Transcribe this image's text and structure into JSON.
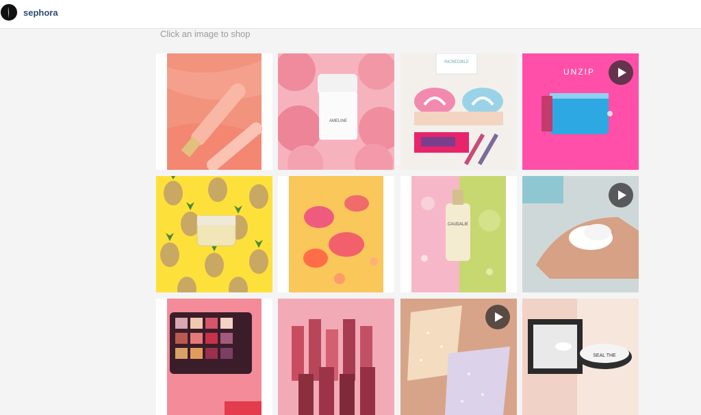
{
  "profile": {
    "username": "sephora",
    "avatar_icon": "sephora-logo-icon"
  },
  "hint": "Click an image to shop",
  "tiles": [
    {
      "label": "pink gloss tube"
    },
    {
      "label": "rose cream jar",
      "jar_text": "AMELINE"
    },
    {
      "label": "rainbow palette",
      "pack_text": "INCREDIBLE"
    },
    {
      "label": "unzip pouch",
      "overlay_text": "UNZIP",
      "video": true
    },
    {
      "label": "pineapple cream"
    },
    {
      "label": "blush compacts"
    },
    {
      "label": "caudalie serum",
      "bottle_text": "CAUDALIE"
    },
    {
      "label": "hand foam",
      "video": true
    },
    {
      "label": "eyeshadow palette"
    },
    {
      "label": "lipsticks"
    },
    {
      "label": "glitter swatches",
      "video": true
    },
    {
      "label": "compact mirror",
      "jar_text": "SEAL THE"
    }
  ],
  "colors": {
    "accent": "#2d4a72",
    "background": "#f4f4f4",
    "unzip_pink": "#ff4fa8"
  }
}
